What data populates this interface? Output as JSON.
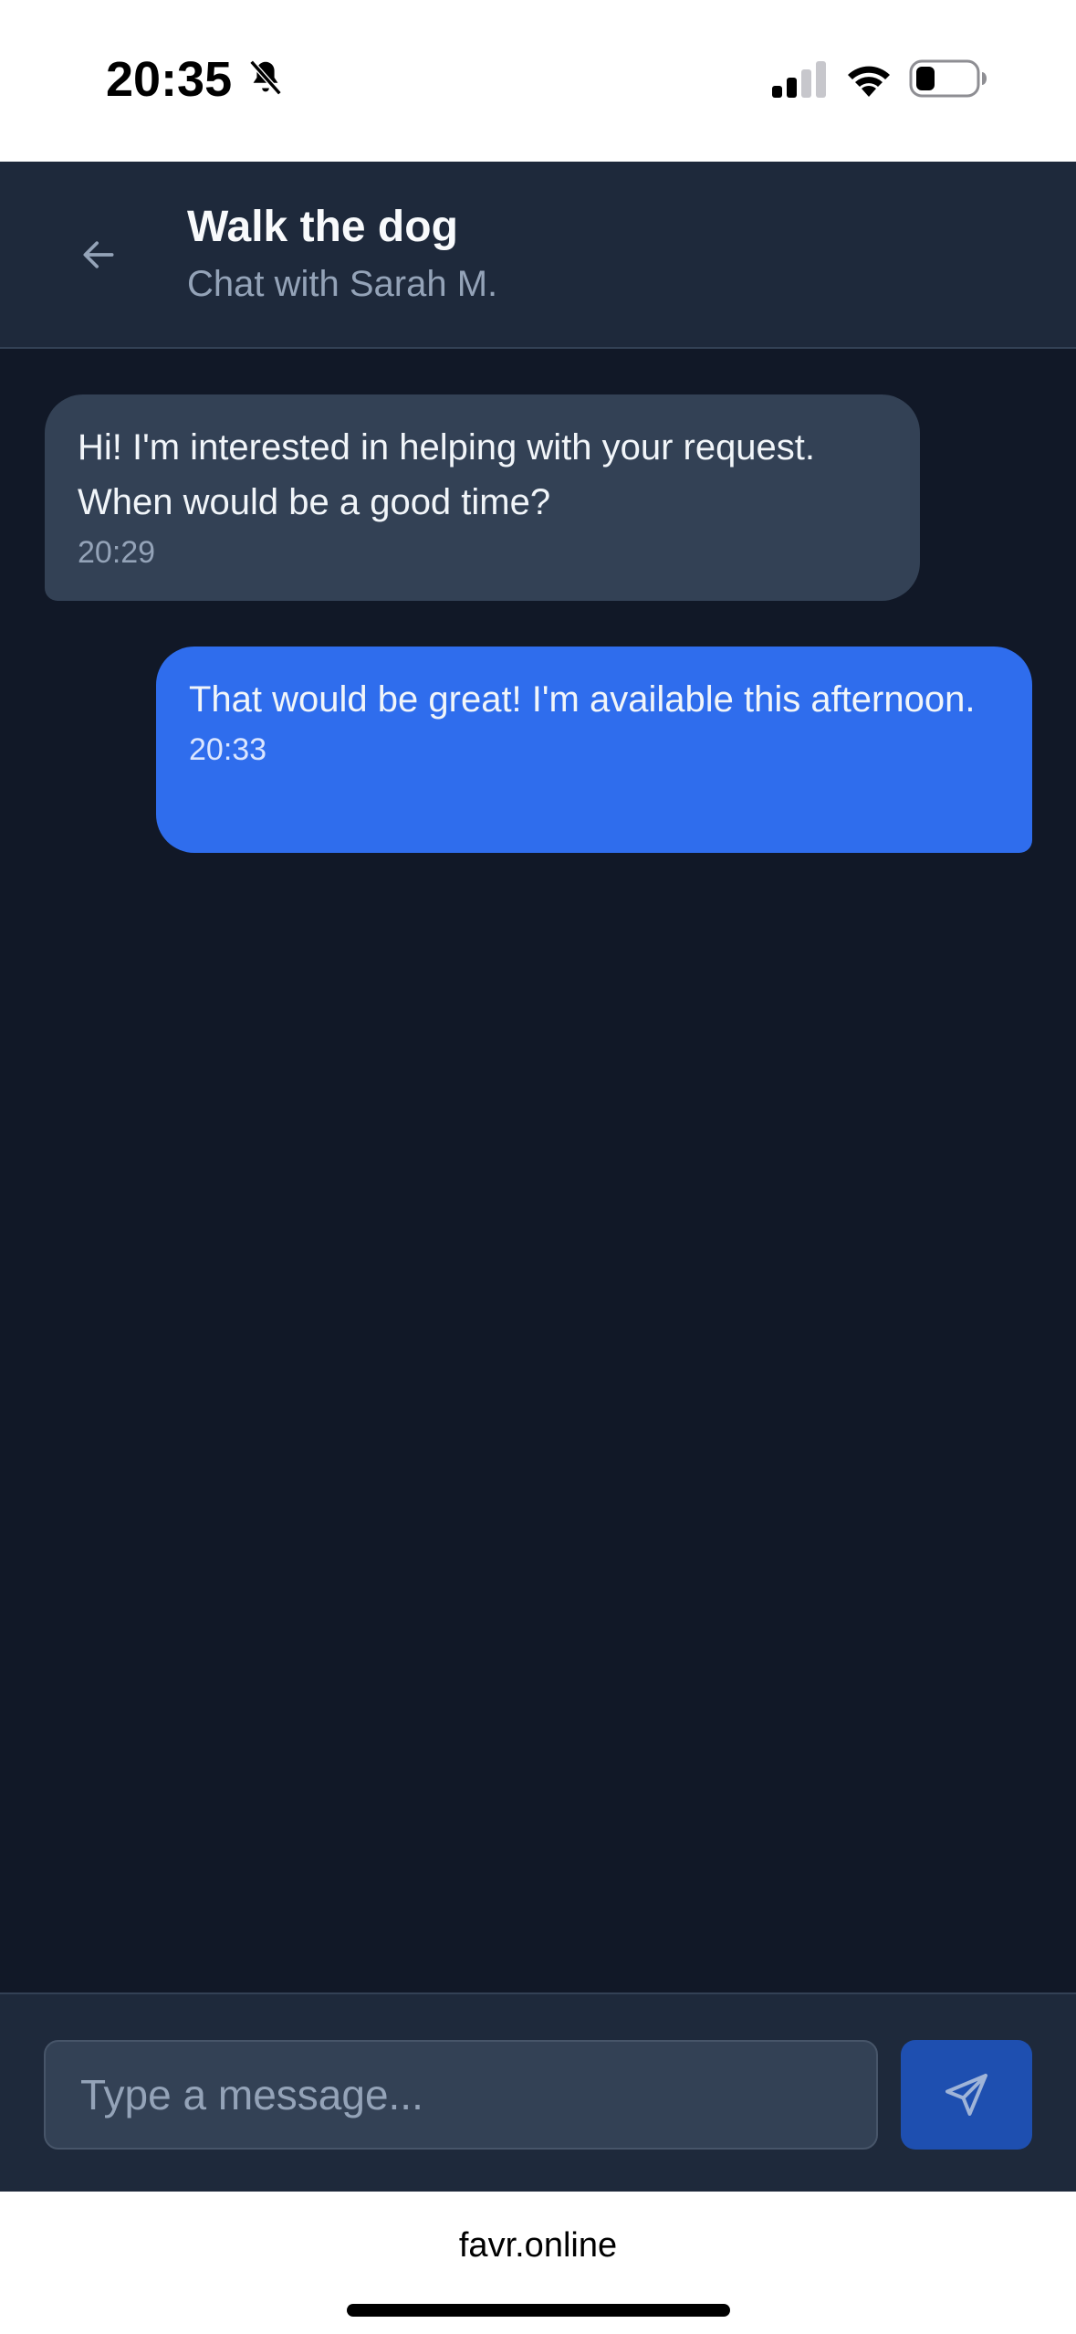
{
  "status_bar": {
    "time": "20:35",
    "icons": [
      "bell-slash-icon",
      "cellular-signal-icon",
      "wifi-icon",
      "battery-icon"
    ]
  },
  "header": {
    "title": "Walk the dog",
    "subtitle": "Chat with Sarah M.",
    "back_icon": "arrow-left-icon"
  },
  "messages": [
    {
      "direction": "incoming",
      "text": "Hi! I'm interested in helping with your request. When would be a good time?",
      "time": "20:29"
    },
    {
      "direction": "outgoing",
      "text": "That would be great! I'm available this afternoon.",
      "time": "20:33"
    }
  ],
  "composer": {
    "placeholder": "Type a message...",
    "value": "",
    "send_icon": "send-icon"
  },
  "browser": {
    "url": "favr.online"
  },
  "colors": {
    "header_bg": "#1e293b",
    "chat_bg": "#111827",
    "incoming_bubble": "#334155",
    "outgoing_bubble": "#2f6ded",
    "send_button": "#1e4fb0"
  }
}
